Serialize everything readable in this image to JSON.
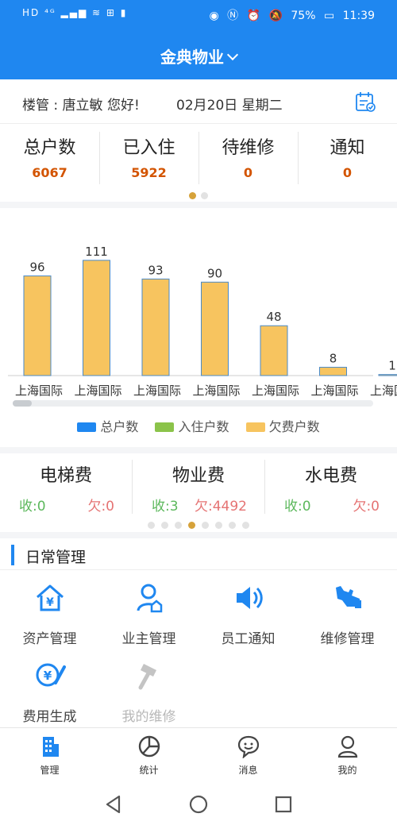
{
  "statusbar": {
    "left": "HD ⁴ᴳ ▂▄▆ ≋ ⊞ ▮",
    "battery": "75%",
    "time": "11:39"
  },
  "header": {
    "title": "金典物业"
  },
  "greeting": {
    "text": "楼管 : 唐立敏 您好!",
    "date": "02月20日 星期二"
  },
  "stats": [
    {
      "label": "总户数",
      "value": "6067"
    },
    {
      "label": "已入住",
      "value": "5922"
    },
    {
      "label": "待维修",
      "value": "0"
    },
    {
      "label": "通知",
      "value": "0"
    }
  ],
  "colors": {
    "primary": "#1f87f0",
    "accent": "#d6a23a",
    "bar": "#f7c45f",
    "green": "#5cb85c",
    "red": "#e57373"
  },
  "chart_data": {
    "type": "bar",
    "categories": [
      "上海国际",
      "上海国际",
      "上海国际",
      "上海国际",
      "上海国际",
      "上海国际",
      "上海国际"
    ],
    "series": [
      {
        "name": "总户数",
        "color": "#1f87f0",
        "values": []
      },
      {
        "name": "入住户数",
        "color": "#8bc34a",
        "values": []
      },
      {
        "name": "欠费户数",
        "color": "#f7c45f",
        "values": [
          96,
          111,
          93,
          90,
          48,
          8,
          1
        ]
      }
    ],
    "value_labels": [
      "96",
      "111",
      "93",
      "90",
      "48",
      "8",
      "1"
    ],
    "ylim": [
      0,
      130
    ],
    "legend": "bottom-center",
    "grid": false
  },
  "fees": [
    {
      "label": "电梯费",
      "shou": "收:0",
      "qian": "欠:0"
    },
    {
      "label": "物业费",
      "shou": "收:3",
      "qian": "欠:4492"
    },
    {
      "label": "水电费",
      "shou": "收:0",
      "qian": "欠:0"
    }
  ],
  "section": {
    "title": "日常管理"
  },
  "menu": [
    {
      "label": "资产管理",
      "icon": "house-yen-icon"
    },
    {
      "label": "业主管理",
      "icon": "owner-icon"
    },
    {
      "label": "员工通知",
      "icon": "speaker-icon"
    },
    {
      "label": "维修管理",
      "icon": "wrench-icon"
    },
    {
      "label": "费用生成",
      "icon": "fee-pen-icon"
    },
    {
      "label": "我的维修",
      "icon": "hammer-icon"
    }
  ],
  "tabs": [
    {
      "label": "管理",
      "icon": "building-icon"
    },
    {
      "label": "统计",
      "icon": "pie-chart-icon"
    },
    {
      "label": "消息",
      "icon": "chat-icon"
    },
    {
      "label": "我的",
      "icon": "user-icon"
    }
  ]
}
